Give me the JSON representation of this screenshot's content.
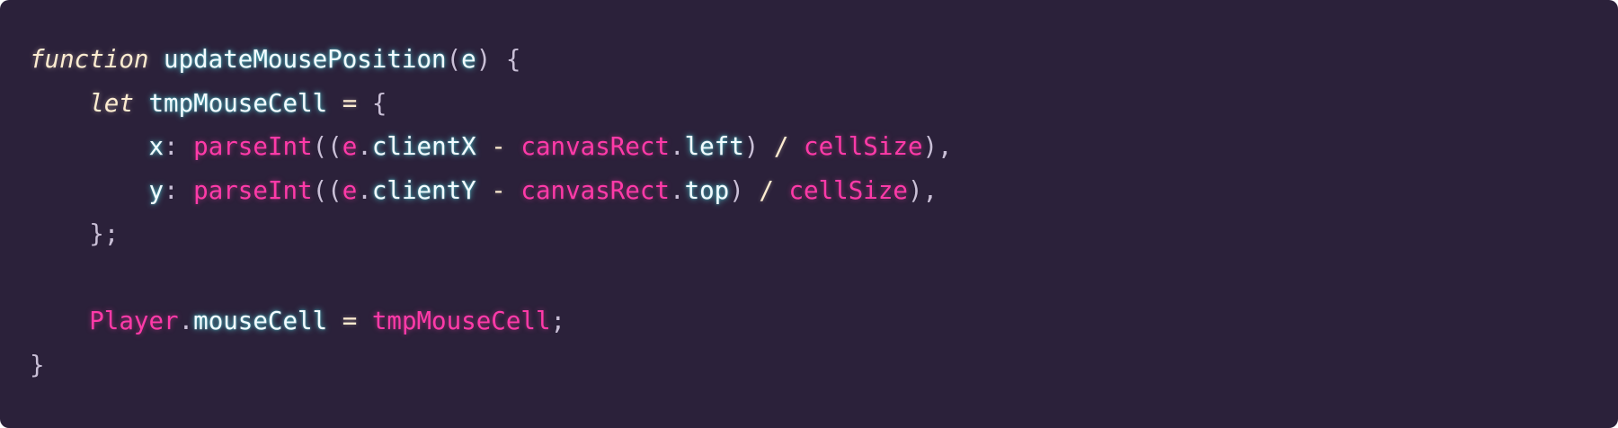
{
  "code": {
    "lines": [
      [
        {
          "t": "function",
          "k": "kw"
        },
        {
          "t": " ",
          "k": "punc"
        },
        {
          "t": "updateMousePosition",
          "k": "id"
        },
        {
          "t": "(",
          "k": "punc"
        },
        {
          "t": "e",
          "k": "id"
        },
        {
          "t": ") {",
          "k": "punc"
        }
      ],
      [
        {
          "t": "    ",
          "k": "punc"
        },
        {
          "t": "let",
          "k": "kw"
        },
        {
          "t": " ",
          "k": "punc"
        },
        {
          "t": "tmpMouseCell",
          "k": "id"
        },
        {
          "t": " = ",
          "k": "op"
        },
        {
          "t": "{",
          "k": "punc"
        }
      ],
      [
        {
          "t": "        ",
          "k": "punc"
        },
        {
          "t": "x",
          "k": "id"
        },
        {
          "t": ": ",
          "k": "punc"
        },
        {
          "t": "parseInt",
          "k": "pink"
        },
        {
          "t": "((",
          "k": "punc"
        },
        {
          "t": "e",
          "k": "pink"
        },
        {
          "t": ".",
          "k": "punc"
        },
        {
          "t": "clientX",
          "k": "id"
        },
        {
          "t": " - ",
          "k": "op"
        },
        {
          "t": "canvasRect",
          "k": "pink"
        },
        {
          "t": ".",
          "k": "punc"
        },
        {
          "t": "left",
          "k": "id"
        },
        {
          "t": ") ",
          "k": "punc"
        },
        {
          "t": "/",
          "k": "op"
        },
        {
          "t": " ",
          "k": "punc"
        },
        {
          "t": "cellSize",
          "k": "pink"
        },
        {
          "t": "),",
          "k": "punc"
        }
      ],
      [
        {
          "t": "        ",
          "k": "punc"
        },
        {
          "t": "y",
          "k": "id"
        },
        {
          "t": ": ",
          "k": "punc"
        },
        {
          "t": "parseInt",
          "k": "pink"
        },
        {
          "t": "((",
          "k": "punc"
        },
        {
          "t": "e",
          "k": "pink"
        },
        {
          "t": ".",
          "k": "punc"
        },
        {
          "t": "clientY",
          "k": "id"
        },
        {
          "t": " - ",
          "k": "op"
        },
        {
          "t": "canvasRect",
          "k": "pink"
        },
        {
          "t": ".",
          "k": "punc"
        },
        {
          "t": "top",
          "k": "id"
        },
        {
          "t": ") ",
          "k": "punc"
        },
        {
          "t": "/",
          "k": "op"
        },
        {
          "t": " ",
          "k": "punc"
        },
        {
          "t": "cellSize",
          "k": "pink"
        },
        {
          "t": "),",
          "k": "punc"
        }
      ],
      [
        {
          "t": "    ",
          "k": "punc"
        },
        {
          "t": "};",
          "k": "punc"
        }
      ],
      [],
      [
        {
          "t": "    ",
          "k": "punc"
        },
        {
          "t": "Player",
          "k": "pink"
        },
        {
          "t": ".",
          "k": "punc"
        },
        {
          "t": "mouseCell",
          "k": "id"
        },
        {
          "t": " = ",
          "k": "op"
        },
        {
          "t": "tmpMouseCell",
          "k": "pink"
        },
        {
          "t": ";",
          "k": "punc"
        }
      ],
      [
        {
          "t": "}",
          "k": "punc"
        }
      ]
    ]
  },
  "colors": {
    "background": "#2b213a",
    "keyword": "#fdecd0",
    "identifier_glow": "#5ce0e8",
    "accent_pink": "#ff3aa8",
    "punctuation": "#c9bfd6"
  }
}
